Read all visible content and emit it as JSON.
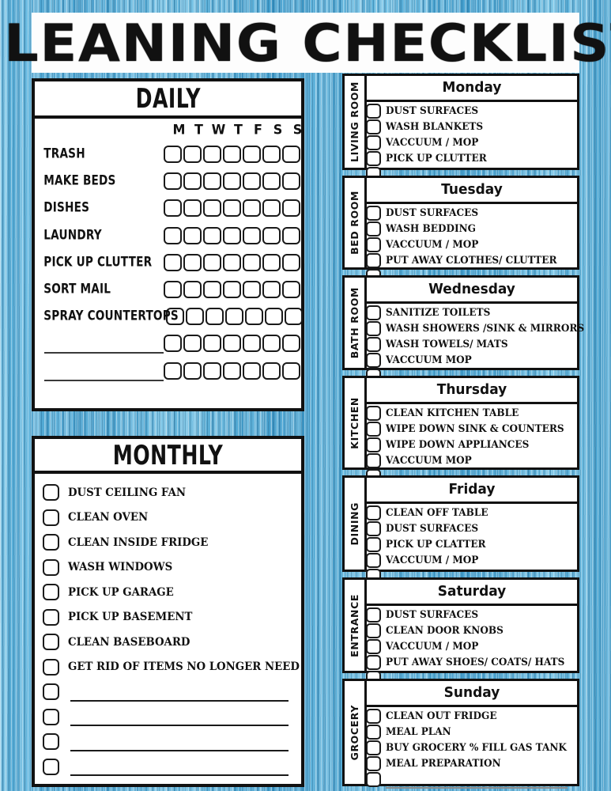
{
  "title": "CLEANING CHECKLIST",
  "theme": {
    "background_color": "#5bb3df",
    "panel_background": "#ffffff",
    "ink_color": "#111111"
  },
  "daily": {
    "heading": "DAILY",
    "day_headers": [
      "M",
      "T",
      "W",
      "T",
      "F",
      "S",
      "S"
    ],
    "checkbox_columns": 7,
    "rows": [
      {
        "label": "TRASH",
        "blank": false
      },
      {
        "label": "MAKE BEDS",
        "blank": false
      },
      {
        "label": "DISHES",
        "blank": false
      },
      {
        "label": "LAUNDRY",
        "blank": false
      },
      {
        "label": "PICK UP CLUTTER",
        "blank": false
      },
      {
        "label": "SORT MAIL",
        "blank": false
      },
      {
        "label": "SPRAY COUNTERTOPS",
        "blank": false
      },
      {
        "label": "",
        "blank": true
      },
      {
        "label": "",
        "blank": true
      }
    ]
  },
  "monthly": {
    "heading": "MONTHLY",
    "rows": [
      {
        "label": "DUST CEILING FAN",
        "blank": false
      },
      {
        "label": "CLEAN OVEN",
        "blank": false
      },
      {
        "label": "CLEAN INSIDE FRIDGE",
        "blank": false
      },
      {
        "label": "WASH WINDOWS",
        "blank": false
      },
      {
        "label": "PICK UP GARAGE",
        "blank": false
      },
      {
        "label": "PICK UP BASEMENT",
        "blank": false
      },
      {
        "label": "CLEAN BASEBOARD",
        "blank": false
      },
      {
        "label": "GET RID OF ITEMS NO LONGER NEED",
        "blank": false
      },
      {
        "label": "",
        "blank": true
      },
      {
        "label": "",
        "blank": true
      },
      {
        "label": "",
        "blank": true
      },
      {
        "label": "",
        "blank": true
      }
    ]
  },
  "days": [
    {
      "day": "Monday",
      "room": "LIVING ROOM",
      "items": [
        "DUST SURFACES",
        "WASH BLANKETS",
        "VACCUUM / MOP",
        "PICK UP CLUTTER"
      ],
      "blank_rows": 1
    },
    {
      "day": "Tuesday",
      "room": "BED ROOM",
      "items": [
        "DUST SURFACES",
        "WASH BEDDING",
        "VACCUUM / MOP",
        "PUT AWAY CLOTHES/ CLUTTER"
      ],
      "blank_rows": 1
    },
    {
      "day": "Wednesday",
      "room": "BATH ROOM",
      "items": [
        "SANITIZE TOILETS",
        "WASH SHOWERS /SINK & MIRRORS",
        "WASH TOWELS/ MATS",
        "VACCUUM MOP"
      ],
      "blank_rows": 1
    },
    {
      "day": "Thursday",
      "room": "KITCHEN",
      "items": [
        "CLEAN KITCHEN TABLE",
        "WIPE DOWN SINK & COUNTERS",
        "WIPE DOWN APPLIANCES",
        "VACCUUM MOP"
      ],
      "blank_rows": 1
    },
    {
      "day": "Friday",
      "room": "DINING",
      "items": [
        "CLEAN OFF TABLE",
        "DUST SURFACES",
        "PICK UP CLATTER",
        "VACCUUM / MOP"
      ],
      "blank_rows": 1
    },
    {
      "day": "Saturday",
      "room": "ENTRANCE",
      "items": [
        "DUST SURFACES",
        "CLEAN DOOR KNOBS",
        "VACCUUM / MOP",
        "PUT AWAY SHOES/ COATS/ HATS"
      ],
      "blank_rows": 1
    },
    {
      "day": "Sunday",
      "room": "GROCERY",
      "items": [
        "CLEAN OUT FRIDGE",
        "MEAL PLAN",
        "BUY GROCERY % FILL GAS TANK",
        "MEAL PREPARATION"
      ],
      "blank_rows": 1
    }
  ]
}
